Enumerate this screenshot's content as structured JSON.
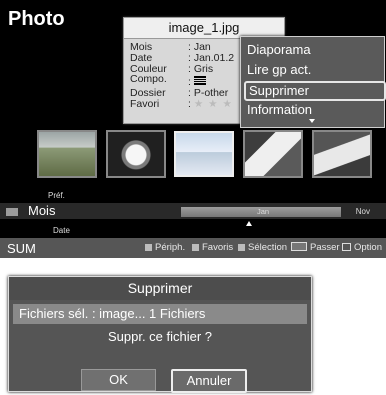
{
  "screen": {
    "title": "Photo",
    "info_panel": {
      "title": "image_1.jpg",
      "rows": [
        {
          "key": "Mois",
          "value": ": Jan"
        },
        {
          "key": "Date",
          "value": ": Jan.01.2"
        },
        {
          "key": "Couleur",
          "value": ": Gris"
        },
        {
          "key": "Compo.",
          "value": ": "
        },
        {
          "key": "Dossier",
          "value": ": P-other"
        },
        {
          "key": "Favori",
          "value": ": "
        }
      ],
      "stars": "★ ★ ★"
    },
    "menu": {
      "items": [
        "Diaporama",
        "Lire gp act.",
        "Supprimer",
        "Information"
      ],
      "selected": "Supprimer"
    },
    "navigation": {
      "prev": "Préf.",
      "group": "Mois",
      "next": "Date"
    },
    "timeline": {
      "current": "Jan",
      "end": "Nov"
    },
    "bottom": {
      "label": "SUM",
      "help": {
        "device": "Périph.",
        "favorites": "Favoris",
        "selection": "Sélection",
        "skip": "Passer",
        "options": "Option"
      }
    }
  },
  "dialog": {
    "title": "Supprimer",
    "file_info": "Fichiers sél. : image... 1 Fichiers",
    "message": "Suppr. ce fichier ?",
    "ok": "OK",
    "cancel": "Annuler"
  },
  "colors": {
    "accent": "#ffffff",
    "panel": "#565656",
    "selection": "#e6e6e6"
  }
}
